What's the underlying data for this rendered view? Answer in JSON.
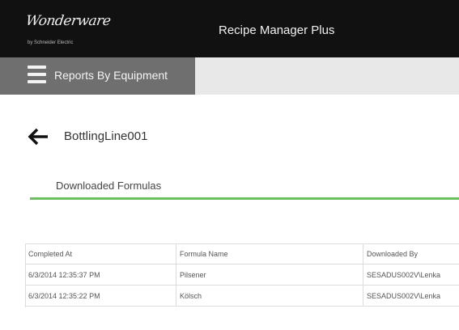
{
  "brand": {
    "logo_text": "Wonderware",
    "logo_sub": "by Schneider Electric"
  },
  "header": {
    "app_title": "Recipe Manager Plus"
  },
  "nav": {
    "title": "Reports By Equipment",
    "menu_icon": "hamburger-menu-icon"
  },
  "page": {
    "back_icon": "arrow-left-icon",
    "equipment_name": "BottlingLine001",
    "tab_label": "Downloaded Formulas"
  },
  "table": {
    "headers": [
      "Completed At",
      "Formula Name",
      "Downloaded By"
    ],
    "rows": [
      [
        "6/3/2014 12:35:37 PM",
        "Pilsener",
        "SESADUS002V\\Lenka"
      ],
      [
        "6/3/2014 12:35:22 PM",
        "Kölsch",
        "SESADUS002V\\Lenka"
      ]
    ]
  },
  "colors": {
    "header_bg": "#111111",
    "nav_bg": "#6f6f6f",
    "nav_right_bg": "#e8e8e8",
    "accent_green": "#6cbf5e"
  }
}
